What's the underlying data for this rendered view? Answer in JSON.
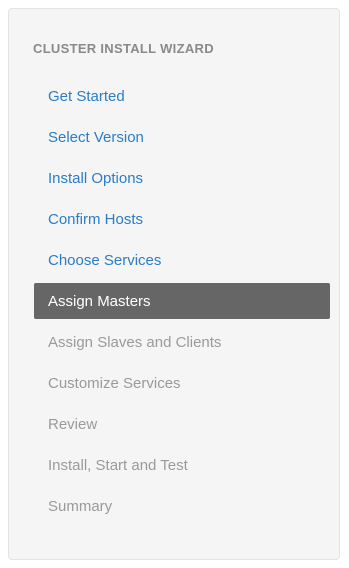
{
  "wizard": {
    "title": "CLUSTER INSTALL WIZARD",
    "steps": [
      {
        "label": "Get Started",
        "state": "completed"
      },
      {
        "label": "Select Version",
        "state": "completed"
      },
      {
        "label": "Install Options",
        "state": "completed"
      },
      {
        "label": "Confirm Hosts",
        "state": "completed"
      },
      {
        "label": "Choose Services",
        "state": "completed"
      },
      {
        "label": "Assign Masters",
        "state": "active"
      },
      {
        "label": "Assign Slaves and Clients",
        "state": "pending"
      },
      {
        "label": "Customize Services",
        "state": "pending"
      },
      {
        "label": "Review",
        "state": "pending"
      },
      {
        "label": "Install, Start and Test",
        "state": "pending"
      },
      {
        "label": "Summary",
        "state": "pending"
      }
    ]
  },
  "colors": {
    "link": "#2a7dc6",
    "active_bg": "#666666",
    "pending_text": "#9a9a9a",
    "panel_bg": "#f5f5f5"
  }
}
